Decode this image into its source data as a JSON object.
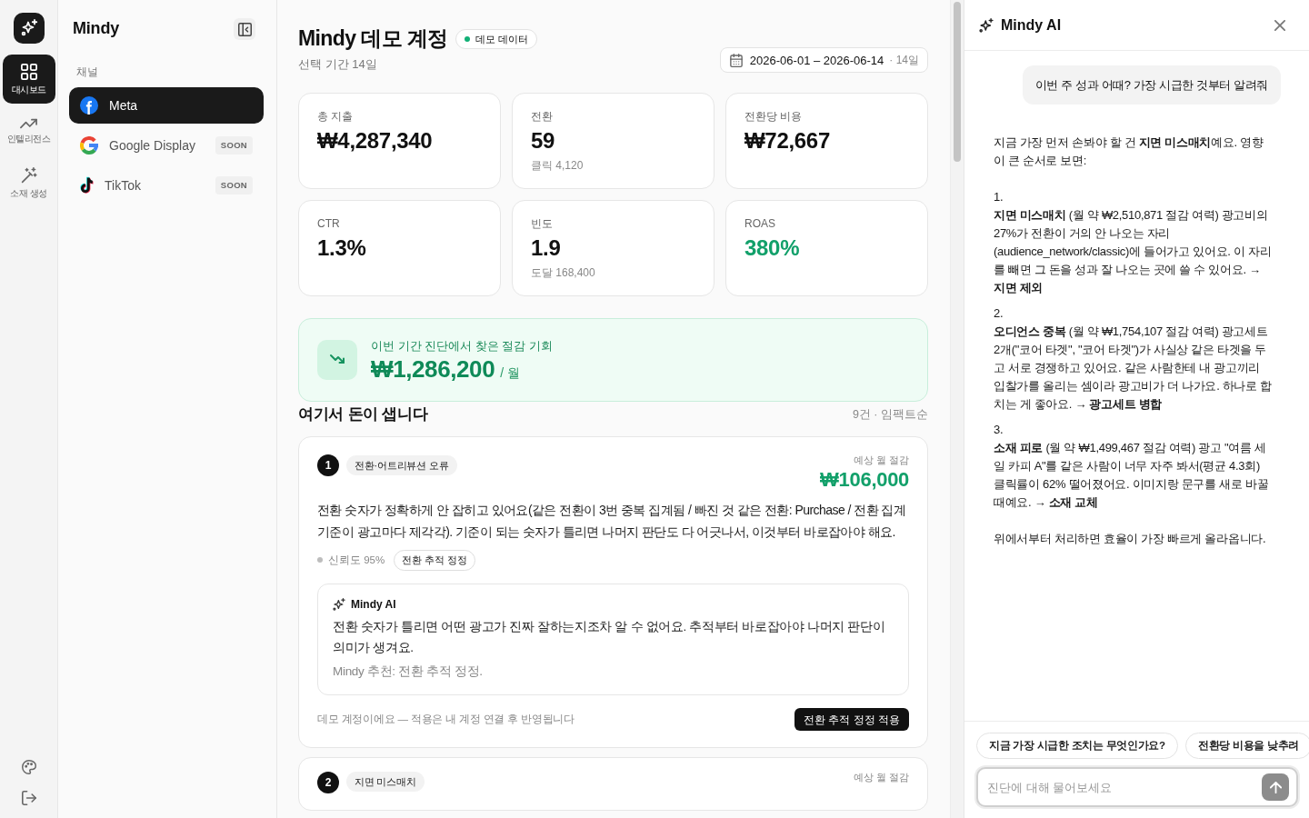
{
  "rail": {
    "items": [
      {
        "label": "대시보드",
        "selected": true
      },
      {
        "label": "인텔리전스",
        "selected": false
      },
      {
        "label": "소재 생성",
        "selected": false
      }
    ]
  },
  "sidebar": {
    "title": "Mindy",
    "section_label": "채널",
    "channels": [
      {
        "name": "Meta",
        "selected": true
      },
      {
        "name": "Google Display",
        "selected": false,
        "badge": "SOON"
      },
      {
        "name": "TikTok",
        "selected": false,
        "badge": "SOON"
      }
    ]
  },
  "header": {
    "title": "Mindy 데모 계정",
    "badge": "데모 데이터",
    "subtitle": "선택 기간 14일",
    "date_range": "2026-06-01 – 2026-06-14",
    "date_days": "· 14일"
  },
  "kpis": [
    {
      "label": "총 지출",
      "value": "₩4,287,340",
      "highlighted": false
    },
    {
      "label": "전환",
      "value": "59",
      "note": "클릭 4,120",
      "highlighted": false
    },
    {
      "label": "전환당 비용",
      "value": "₩72,667",
      "highlighted": false
    },
    {
      "label": "CTR",
      "value": "1.3%",
      "highlighted": false
    },
    {
      "label": "빈도",
      "value": "1.9",
      "note": "도달 168,400",
      "highlighted": false
    },
    {
      "label": "ROAS",
      "value": "380%",
      "highlighted": true
    }
  ],
  "savings": {
    "label": "이번 기간 진단에서 찾은 절감 기회",
    "amount": "₩1,286,200",
    "unit": "/ 월"
  },
  "issues_header": {
    "title": "여기서 돈이 샙니다",
    "meta": "9건 · 임팩트순"
  },
  "issues": [
    {
      "number": "1",
      "category": "전환·어트리뷰션 오류",
      "saving_label": "예상 월 절감",
      "saving": "₩106,000",
      "description": "전환 숫자가 정확하게 안 잡히고 있어요(같은 전환이 3번 중복 집계됨 / 빠진 것 같은 전환: Purchase / 전환 집계 기준이 광고마다 제각각). 기준이 되는 숫자가 틀리면 나머지 판단도 다 어긋나서, 이것부터 바로잡아야 해요.",
      "confidence": "신뢰도 95%",
      "action_tag": "전환 추적 정정",
      "ai": {
        "title": "Mindy AI",
        "text": "전환 숫자가 틀리면 어떤 광고가 진짜 잘하는지조차 알 수 없어요. 추적부터 바로잡아야 나머지 판단이 의미가 생겨요.",
        "recommendation": "Mindy 추천: 전환 추적 정정."
      },
      "footer_note": "데모 계정이에요 — 적용은 내 계정 연결 후 반영됩니다",
      "action_button": "전환 추적 정정 적용"
    },
    {
      "number": "2",
      "category": "지면 미스매치",
      "saving_label": "예상 월 절감"
    }
  ],
  "assistant": {
    "title": "Mindy AI",
    "messages": [
      {
        "kind": "user",
        "text": "이번 주 성과 어때? 가장 시급한 것부터 알려줘"
      },
      {
        "kind": "assistant",
        "intro": "지금 가장 먼저 손봐야 할 건 **지면 미스매치**예요. 영향이 큰 순서로 보면:",
        "items": [
          {
            "number": "1.",
            "text": "**지면 미스매치** (월 약 ₩2,510,871 절감 여력) 광고비의 27%가 전환이 거의 안 나오는 자리 (audience_network/classic)에 들어가고 있어요. 이 자리를 빼면 그 돈을 성과 잘 나오는 곳에 쓸 수 있어요. → **지면 제외**"
          },
          {
            "number": "2.",
            "text": "**오디언스 중복** (월 약 ₩1,754,107 절감 여력) 광고세트 2개(\"코어 타겟\", \"코어 타겟\")가 사실상 같은 타겟을 두고 서로 경쟁하고 있어요. 같은 사람한테 내 광고끼리 입찰가를 올리는 셈이라 광고비가 더 나가요. 하나로 합치는 게 좋아요. → **광고세트 병합**"
          },
          {
            "number": "3.",
            "text": "**소재 피로** (월 약 ₩1,499,467 절감 여력) 광고 \"여름 세일 카피 A\"를 같은 사람이 너무 자주 봐서(평균 4.3회) 클릭률이 62% 떨어졌어요. 이미지랑 문구를 새로 바꿀 때예요. → **소재 교체**"
          }
        ],
        "outro": "위에서부터 처리하면 효율이 가장 빠르게 올라옵니다."
      }
    ],
    "suggestions": [
      "지금 가장 시급한 조치는 무엇인가요?",
      "전환당 비용을 낮추려"
    ],
    "input": {
      "placeholder": "진단에 대해 물어보세요"
    }
  }
}
